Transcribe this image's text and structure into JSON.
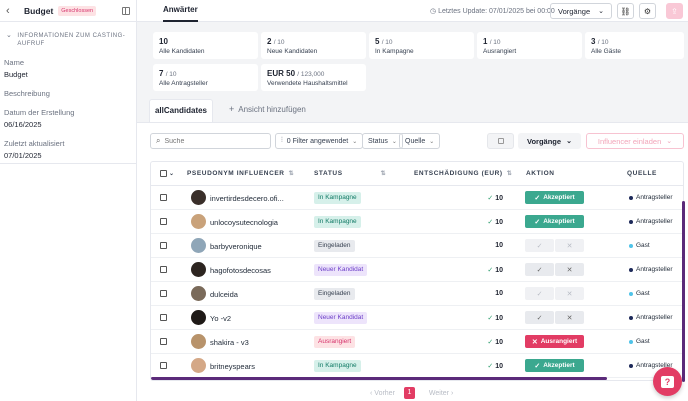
{
  "sidebar": {
    "title": "Budget",
    "badge": "Geschlossen",
    "section_title": "INFORMATIONEN ZUM CASTING-AUFRUF",
    "fields": [
      {
        "label": "Name",
        "value": "Budget"
      },
      {
        "label": "Beschreibung",
        "value": ""
      },
      {
        "label": "Datum der Erstellung",
        "value": "06/16/2025"
      },
      {
        "label": "Zuletzt aktualisiert",
        "value": "07/01/2025"
      }
    ]
  },
  "header": {
    "tab": "Anwärter",
    "last_update": "Letztes Update: 07/01/2025 bei 00:00",
    "vorgaenge": "Vorgänge"
  },
  "stats": [
    {
      "num": "10",
      "of": "",
      "label": "Alle Kandidaten"
    },
    {
      "num": "2",
      "of": "/ 10",
      "label": "Neue Kandidaten"
    },
    {
      "num": "5",
      "of": "/ 10",
      "label": "In Kampagne"
    },
    {
      "num": "1",
      "of": "/ 10",
      "label": "Ausrangiert"
    },
    {
      "num": "3",
      "of": "/ 10",
      "label": "Alle Gäste"
    },
    {
      "num": "7",
      "of": "/ 10",
      "label": "Alle Antragsteller"
    },
    {
      "num": "EUR 50",
      "of": "/ 123,000",
      "label": "Verwendete Haushaltsmittel"
    }
  ],
  "tabs": {
    "active": "allCandidates",
    "add": "Ansicht hinzufügen"
  },
  "toolbar": {
    "search_placeholder": "Suche",
    "filter": "0 Filter angewendet",
    "status": "Status",
    "quelle": "Quelle",
    "vorgaenge": "Vorgänge",
    "invite": "Influencer einladen"
  },
  "table": {
    "headers": {
      "pseudonym": "PSEUDONYM INFLUENCER",
      "status": "STATUS",
      "compensation": "ENTSCHÄDIGUNG (EUR)",
      "action": "AKTION",
      "source": "QUELLE"
    },
    "rows": [
      {
        "name": "invertirdesdecero.ofi...",
        "status": "In Kampagne",
        "comp": "10",
        "approved": true,
        "action": "Akzeptiert",
        "source": "Antragsteller"
      },
      {
        "name": "unlocoysutecnologia",
        "status": "In Kampagne",
        "comp": "10",
        "approved": true,
        "action": "Akzeptiert",
        "source": "Antragsteller"
      },
      {
        "name": "barbyveronique",
        "status": "Eingeladen",
        "comp": "10",
        "approved": false,
        "action": "",
        "source": "Gast"
      },
      {
        "name": "hagofotosdecosas",
        "status": "Neuer Kandidat",
        "comp": "10",
        "approved": true,
        "action": "",
        "source": "Antragsteller"
      },
      {
        "name": "dulceida",
        "status": "Eingeladen",
        "comp": "10",
        "approved": false,
        "action": "",
        "source": "Gast"
      },
      {
        "name": "Yo -v2",
        "status": "Neuer Kandidat",
        "comp": "10",
        "approved": true,
        "action": "",
        "source": "Antragsteller"
      },
      {
        "name": "shakira - v3",
        "status": "Ausrangiert",
        "comp": "10",
        "approved": true,
        "action": "Ausrangiert",
        "source": "Gast"
      },
      {
        "name": "britneyspears",
        "status": "In Kampagne",
        "comp": "10",
        "approved": true,
        "action": "Akzeptiert",
        "source": "Antragsteller"
      }
    ]
  },
  "pagination": {
    "prev": "Vorher",
    "page": "1",
    "next": "Weiter"
  },
  "colors": {
    "accent": "#e23c64",
    "accepted": "#3ba88f",
    "scrollbar": "#5b2a7a"
  }
}
